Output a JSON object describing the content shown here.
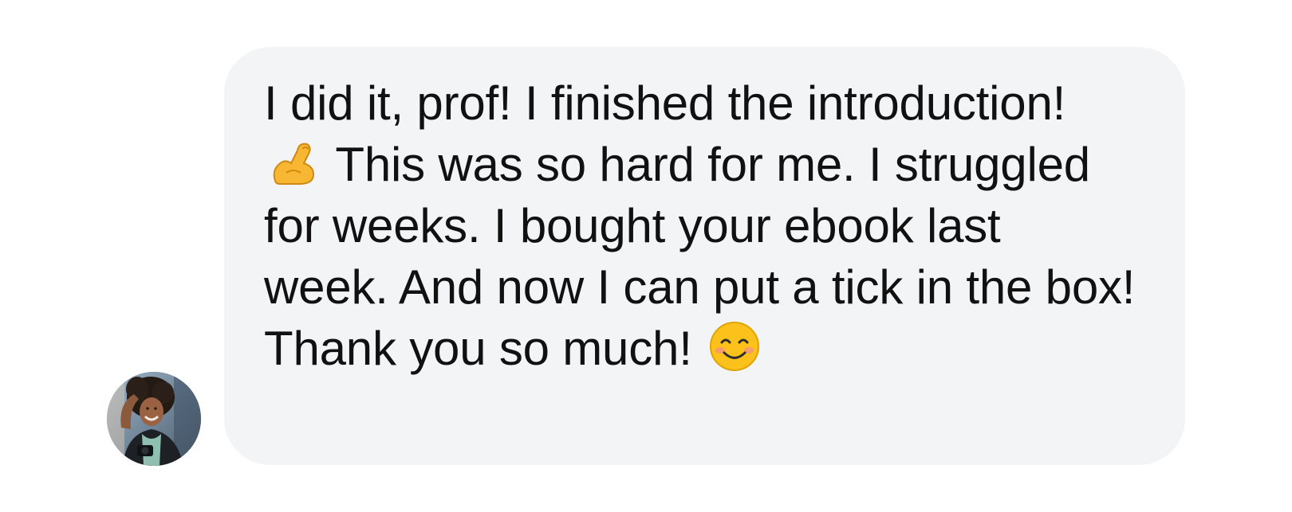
{
  "chat": {
    "message": {
      "segments": [
        "I did it, prof! I finished the introduction!",
        "This was so hard for me. I struggled for weeks. I bought your ebook last week. And now I can put a tick in the box! Thank you so much!"
      ],
      "emojis": [
        "💪",
        "😊"
      ],
      "icons": [
        "flexed-biceps-emoji",
        "smiling-face-emoji"
      ]
    },
    "avatar": {
      "icon": "user-avatar-photo"
    },
    "colors": {
      "bubble_background": "#f3f4f6",
      "text": "#111111",
      "page_background": "#ffffff"
    }
  }
}
